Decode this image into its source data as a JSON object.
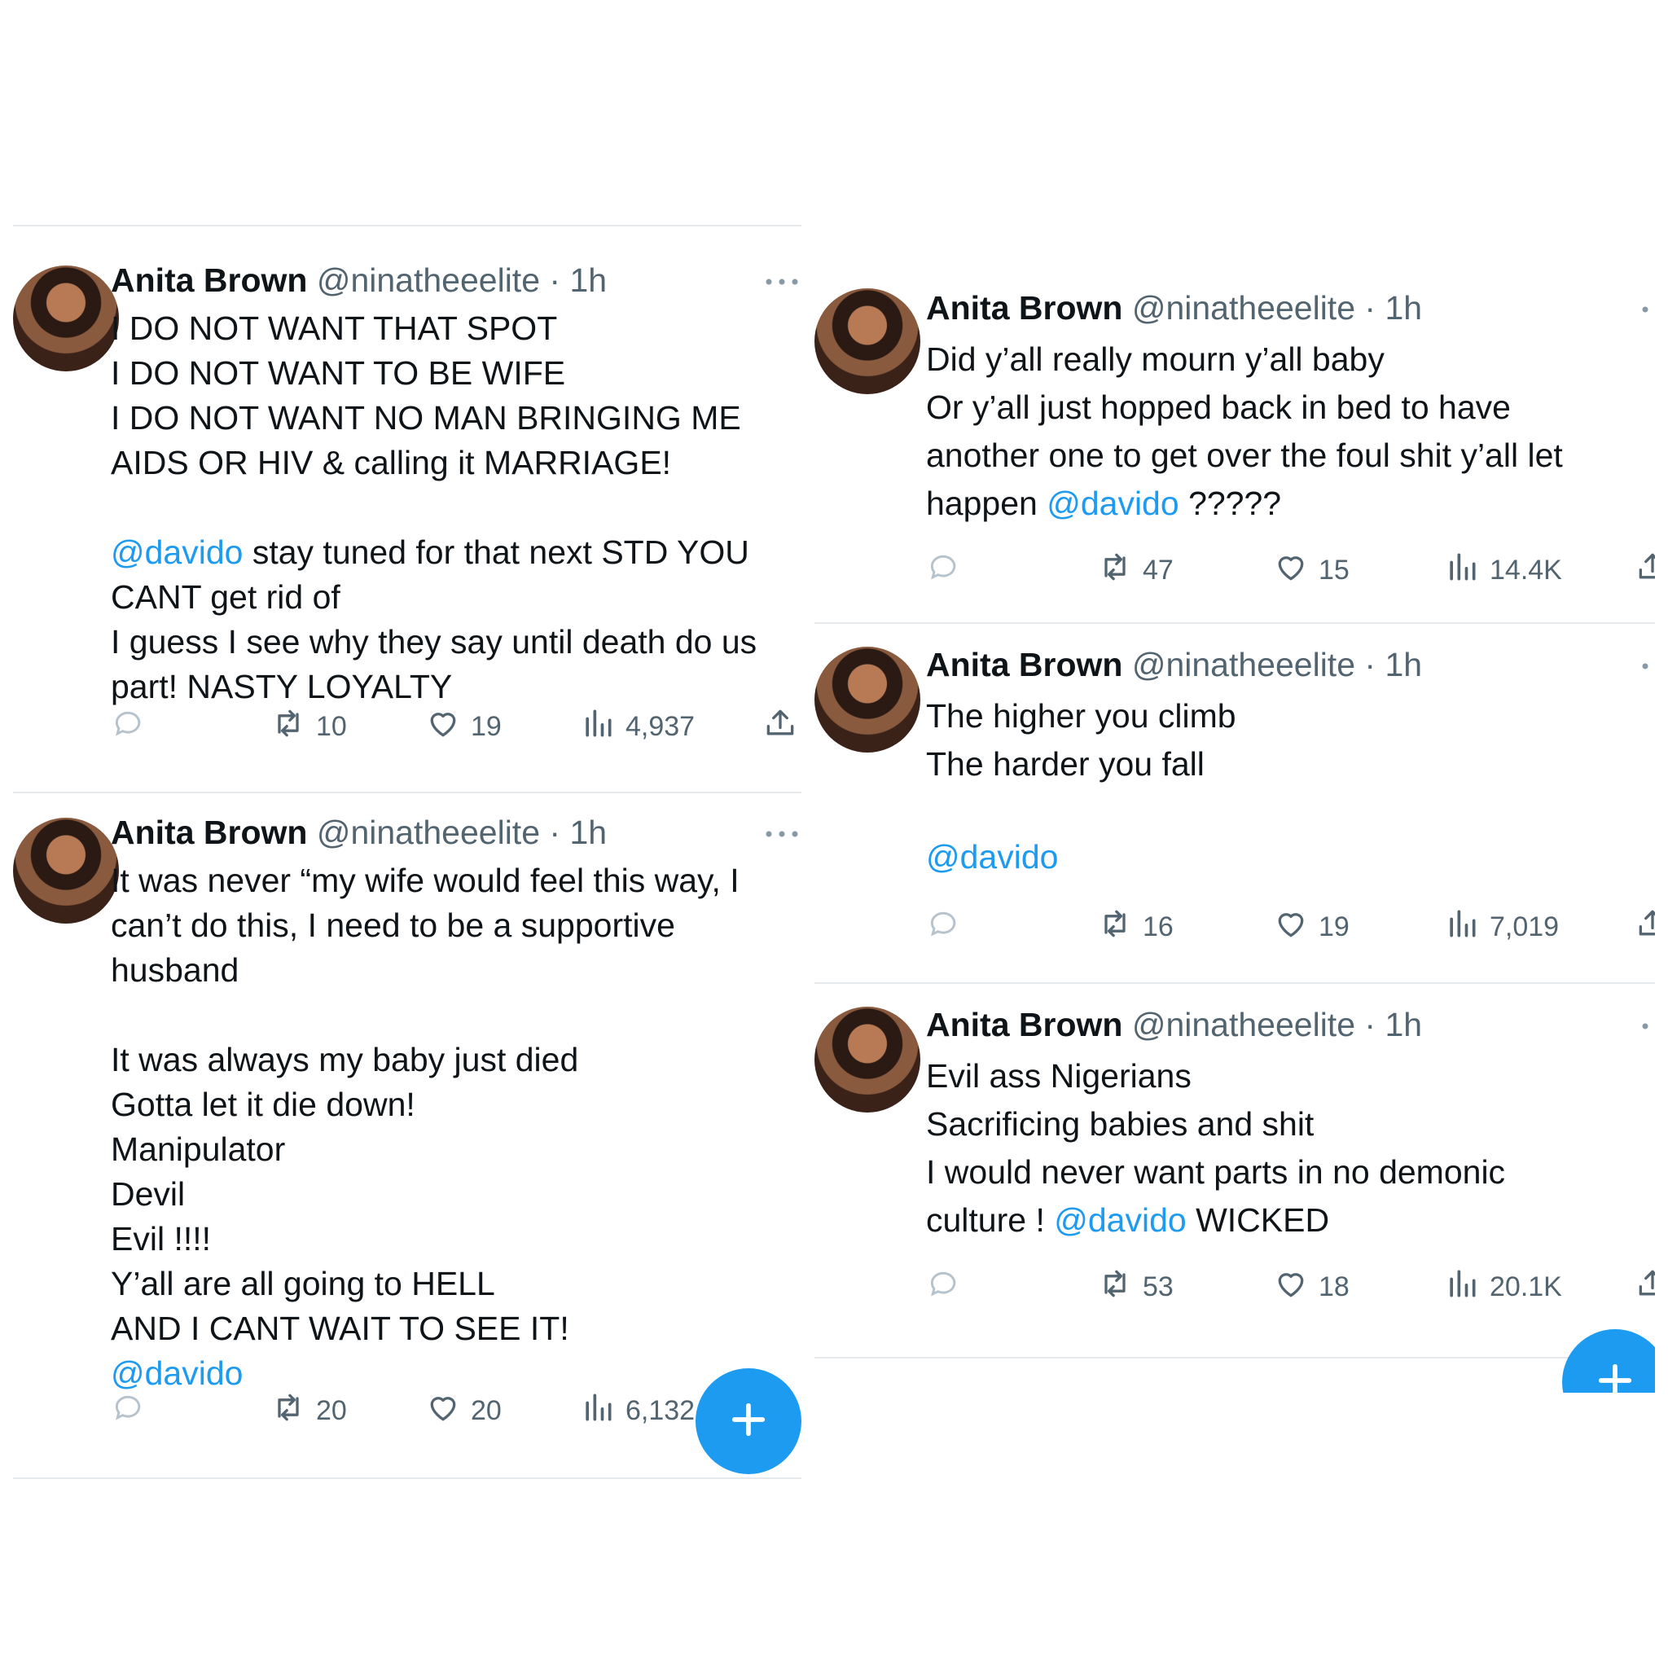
{
  "colors": {
    "accent": "#1d9bf0",
    "text": "#0f1419",
    "muted": "#536471",
    "divider": "#e6e9ec"
  },
  "left_panel": {
    "tweets": [
      {
        "name": "Anita Brown",
        "handle": "@ninatheeelite",
        "separator": "·",
        "time": "1h",
        "lines": [
          [
            {
              "t": "I DO NOT WANT THAT SPOT"
            }
          ],
          [
            {
              "t": "I DO NOT WANT TO BE WIFE"
            }
          ],
          [
            {
              "t": "I DO NOT WANT NO MAN BRINGING ME"
            }
          ],
          [
            {
              "t": "AIDS OR HIV & calling it MARRIAGE!"
            }
          ],
          [
            {
              "t": ""
            }
          ],
          [
            {
              "t": "@davido",
              "mention": true
            },
            {
              "t": " stay tuned for that next STD YOU"
            }
          ],
          [
            {
              "t": "CANT get rid of"
            }
          ],
          [
            {
              "t": "I guess I see why they say until death do us"
            }
          ],
          [
            {
              "t": "part! NASTY LOYALTY"
            }
          ]
        ],
        "retweets": "10",
        "likes": "19",
        "views": "4,937",
        "icons": [
          "reply-icon",
          "retweet-icon",
          "heart-icon",
          "views-icon",
          "share-icon",
          "more-icon"
        ]
      },
      {
        "name": "Anita Brown",
        "handle": "@ninatheeelite",
        "separator": "·",
        "time": "1h",
        "lines": [
          [
            {
              "t": "It was never “my wife would feel this way, I"
            }
          ],
          [
            {
              "t": "can’t do this, I need to be a supportive"
            }
          ],
          [
            {
              "t": "husband"
            }
          ],
          [
            {
              "t": ""
            }
          ],
          [
            {
              "t": "It was always my baby just died"
            }
          ],
          [
            {
              "t": "Gotta let it die down!"
            }
          ],
          [
            {
              "t": "Manipulator"
            }
          ],
          [
            {
              "t": "Devil"
            }
          ],
          [
            {
              "t": "Evil !!!!"
            }
          ],
          [
            {
              "t": "Y’all are all going to HELL"
            }
          ],
          [
            {
              "t": "AND I CANT WAIT TO SEE IT!"
            }
          ],
          [
            {
              "t": "@davido",
              "mention": true
            }
          ]
        ],
        "retweets": "20",
        "likes": "20",
        "views": "6,132",
        "icons": [
          "reply-icon",
          "retweet-icon",
          "heart-icon",
          "views-icon",
          "compose-plus-icon"
        ]
      }
    ]
  },
  "right_panel": {
    "tweets": [
      {
        "name": "Anita Brown",
        "handle": "@ninatheeelite",
        "separator": "·",
        "time": "1h",
        "lines": [
          [
            {
              "t": "Did y’all really mourn y’all baby"
            }
          ],
          [
            {
              "t": "Or y’all just hopped back in bed to have"
            }
          ],
          [
            {
              "t": "another one to get over the foul shit y’all let"
            }
          ],
          [
            {
              "t": "happen "
            },
            {
              "t": "@davido",
              "mention": true
            },
            {
              "t": " ?????"
            }
          ]
        ],
        "retweets": "47",
        "likes": "15",
        "views": "14.4K"
      },
      {
        "name": "Anita Brown",
        "handle": "@ninatheeelite",
        "separator": "·",
        "time": "1h",
        "lines": [
          [
            {
              "t": "The higher you climb"
            }
          ],
          [
            {
              "t": "The harder you fall"
            }
          ],
          [
            {
              "t": ""
            }
          ],
          [
            {
              "t": "@davido",
              "mention": true
            }
          ]
        ],
        "retweets": "16",
        "likes": "19",
        "views": "7,019"
      },
      {
        "name": "Anita Brown",
        "handle": "@ninatheeelite",
        "separator": "·",
        "time": "1h",
        "lines": [
          [
            {
              "t": "Evil ass Nigerians"
            }
          ],
          [
            {
              "t": "Sacrificing babies and shit"
            }
          ],
          [
            {
              "t": "I would never want parts in no demonic"
            }
          ],
          [
            {
              "t": "culture ! "
            },
            {
              "t": "@davido",
              "mention": true
            },
            {
              "t": " WICKED"
            }
          ]
        ],
        "retweets": "53",
        "likes": "18",
        "views": "20.1K"
      }
    ]
  }
}
